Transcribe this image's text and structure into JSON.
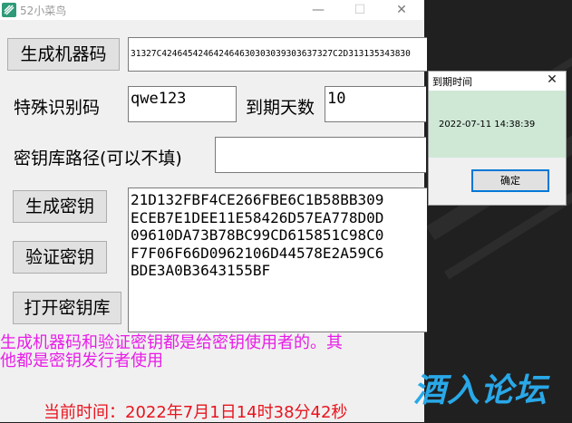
{
  "window": {
    "title": "52小菜鸟",
    "minimize_glyph": "—",
    "maximize_glyph": "☐",
    "close_glyph": "✕"
  },
  "buttons": {
    "generate_machine_code": "生成机器码",
    "generate_key": "生成密钥",
    "verify_key": "验证密钥",
    "open_key_library": "打开密钥库"
  },
  "fields": {
    "machine_code_value": "31327C424645424642464630303039303637327C2D313135343830",
    "special_id_label": "特殊识别码",
    "special_id_value": "qwe123",
    "expire_days_label": "到期天数",
    "expire_days_value": "10",
    "key_lib_path_label": "密钥库路径(可以不填)",
    "key_lib_path_value": "",
    "key_output_value": "21D132FBF4CE266FBE6C1B58BB309\nECEB7E1DEE11E58426D57EA778D0D\n09610DA73B78BC99CD615851C98C0\nF7F06F66D0962106D44578E2A59C6\nBDE3A0B3643155BF"
  },
  "notes": {
    "usage_hint": "生成机器码和验证密钥都是给密钥使用者的。其\n他都是密钥发行者使用",
    "current_time": "当前时间：2022年7月1日14时38分42秒"
  },
  "dialog": {
    "title": "到期时间",
    "close_glyph": "✕",
    "message": "2022-07-11 14:38:39",
    "ok_label": "确定"
  },
  "watermark": {
    "text": "酒入论坛"
  },
  "colors": {
    "hint_text": "#e81ce8",
    "time_text": "#e8141e",
    "watermark": "#29a8e8",
    "dialog_body": "#cfe8d6",
    "app_icon": "#2e9a78"
  }
}
